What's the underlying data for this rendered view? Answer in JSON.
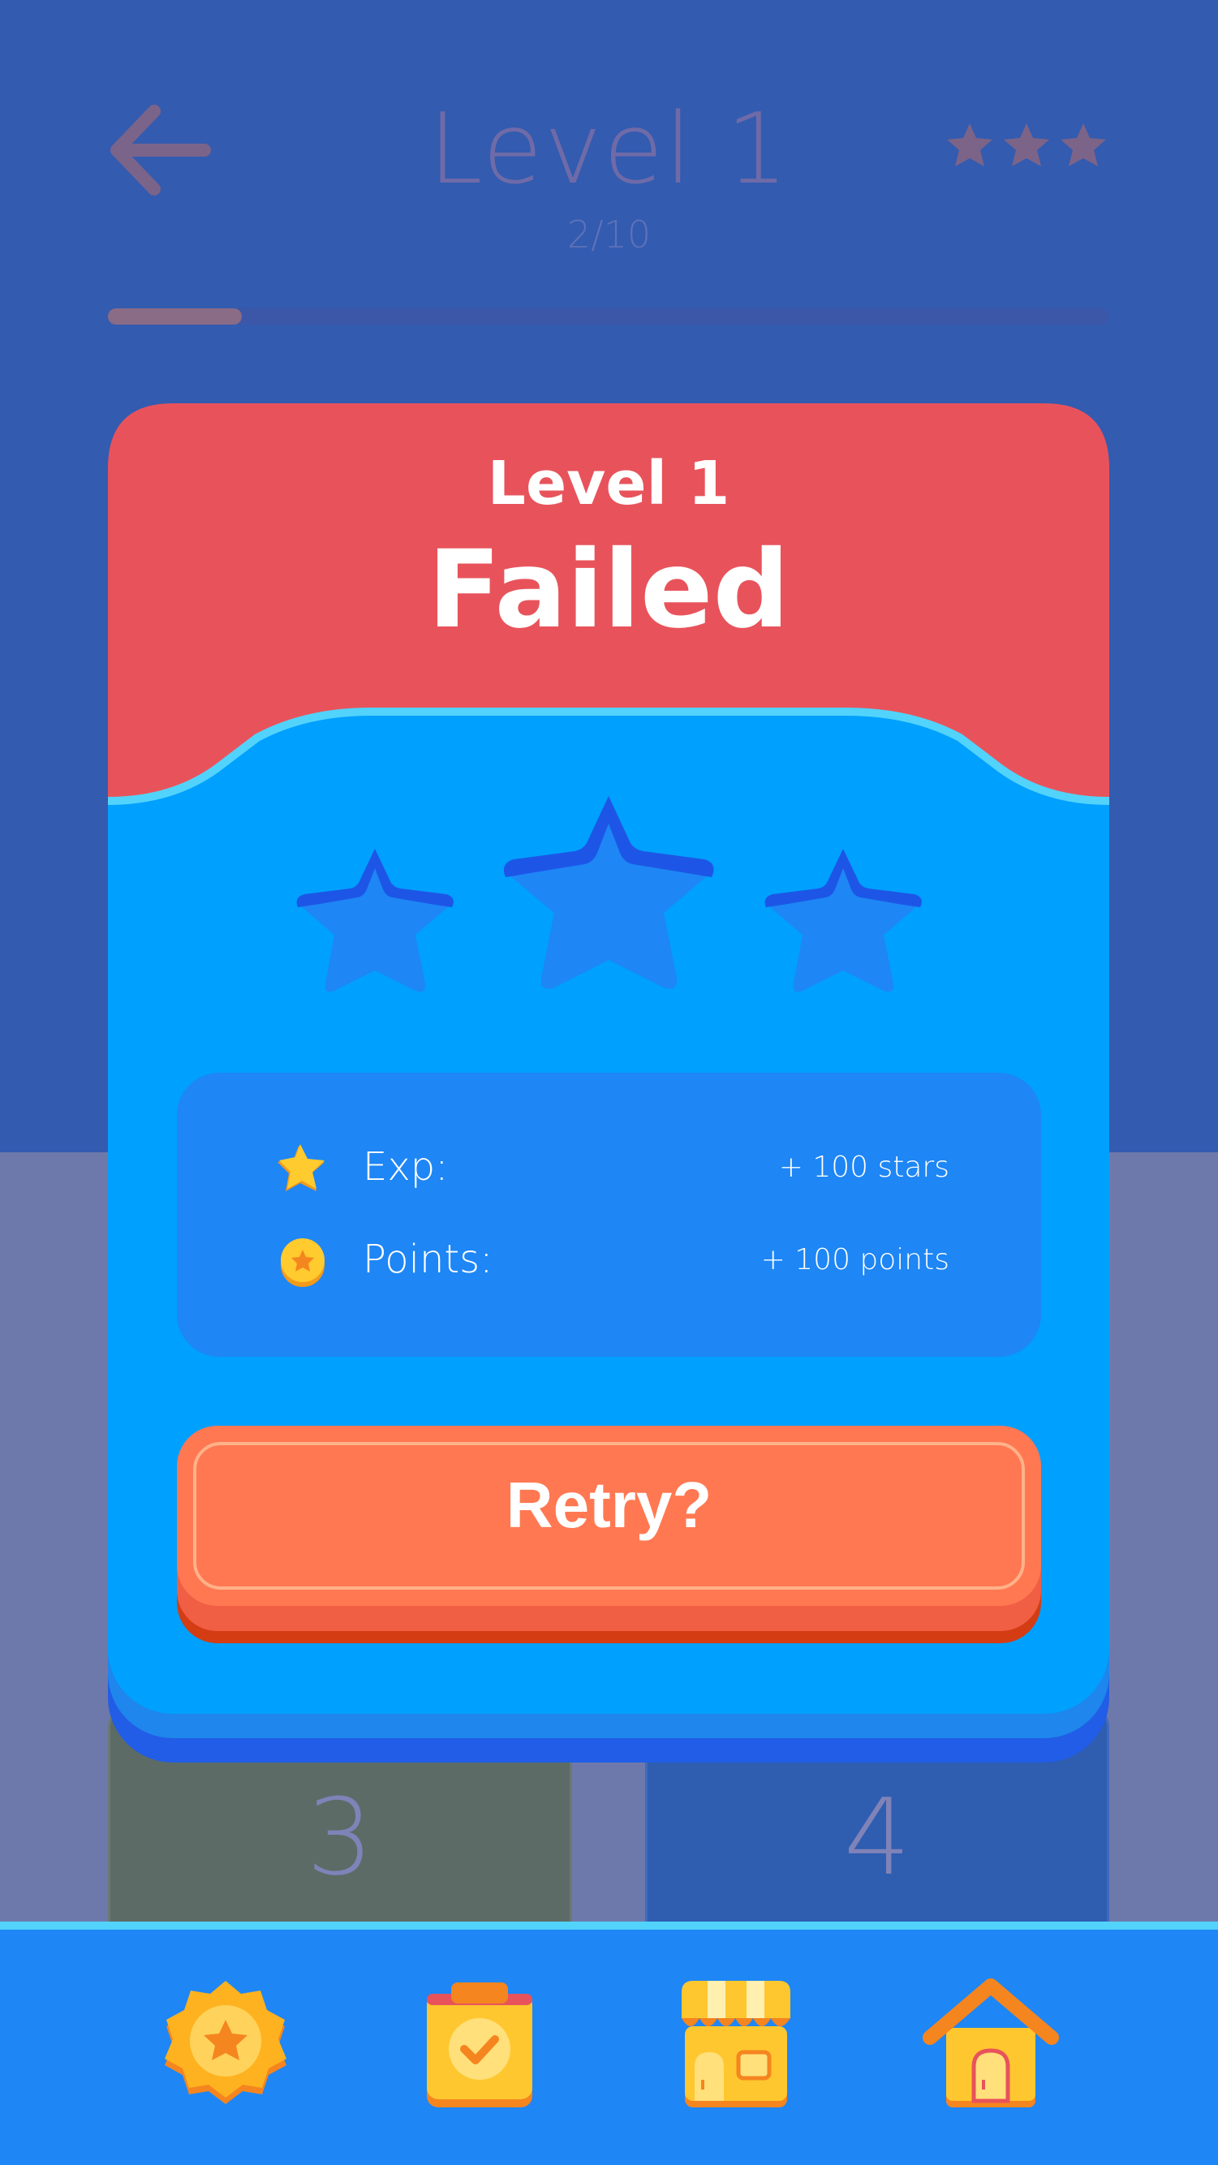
{
  "header": {
    "title": "Level 1",
    "progress_text": "2/10",
    "progress_fraction": 0.2,
    "stars_icon": "star-icon"
  },
  "modal": {
    "level": "Level 1",
    "status": "Failed",
    "stars_earned": 0,
    "stars_total": 3,
    "rewards": [
      {
        "icon": "star-icon",
        "label": "Exp:",
        "value": "+ 100 stars"
      },
      {
        "icon": "coin-icon",
        "label": "Points:",
        "value": "+ 100 points"
      }
    ],
    "retry_label": "Retry?"
  },
  "tiles": [
    {
      "number": "3"
    },
    {
      "number": "4"
    }
  ],
  "nav": [
    {
      "name": "badge",
      "icon": "badge-star-icon"
    },
    {
      "name": "tasks",
      "icon": "clipboard-check-icon"
    },
    {
      "name": "shop",
      "icon": "shop-icon"
    },
    {
      "name": "home",
      "icon": "home-icon"
    }
  ],
  "colors": {
    "header_red": "#e8535b",
    "modal_blue": "#00a0fe",
    "retry_orange": "#ff7852",
    "nav_blue": "#1e86f5",
    "accent_cyan": "#52d3fb"
  }
}
